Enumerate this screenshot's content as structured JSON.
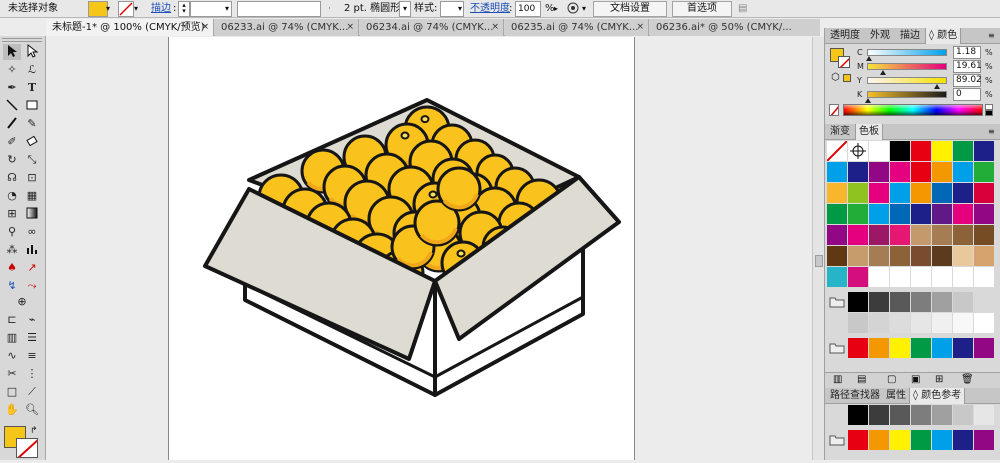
{
  "control_bar": {
    "selection_status": "未选择对象",
    "stroke_label": "描边",
    "stroke_weight_value": "",
    "brush_size_label": "2 pt. 椭圆形",
    "style_label": "样式:",
    "opacity_label": "不透明度",
    "opacity_value": "100",
    "opacity_unit": "%",
    "doc_setup_button": "文档设置",
    "preferences_button": "首选项",
    "fill_color": "#f5c518"
  },
  "tabs": [
    {
      "label": "未标题-1* @ 100% (CMYK/预览)",
      "close": "×"
    },
    {
      "label": "06233.ai @ 74% (CMYK...",
      "close": "×"
    },
    {
      "label": "06234.ai @ 74% (CMYK...",
      "close": "×"
    },
    {
      "label": "06235.ai @ 74% (CMYK...",
      "close": "×"
    },
    {
      "label": "06236.ai* @ 50% (CMYK/...",
      "close": ""
    }
  ],
  "color_panel": {
    "tabs": [
      "透明度",
      "外观",
      "描边",
      "◊ 颜色"
    ],
    "channels": [
      {
        "label": "C",
        "value": "1.18",
        "fraction": 0.0118,
        "track_start": "#ffffff",
        "track_end": "#00a0e9"
      },
      {
        "label": "M",
        "value": "19.61",
        "fraction": 0.1961,
        "track_start": "#f5e53a",
        "track_end": "#e4007f"
      },
      {
        "label": "Y",
        "value": "89.02",
        "fraction": 0.8902,
        "track_start": "#fdf4f4",
        "track_end": "#f5e000"
      },
      {
        "label": "K",
        "value": "0",
        "fraction": 0.0,
        "track_start": "#f6c02a",
        "track_end": "#1a1a1a"
      }
    ],
    "unit": "%"
  },
  "swatches_panel": {
    "tabs": [
      "渐变",
      "色板"
    ],
    "rows": [
      [
        "none",
        "registration",
        "#ffffff",
        "#000000",
        "#e60012",
        "#fff100",
        "#009944",
        "#1d2088",
        "#e4007f",
        "#00a0e9",
        "#e60033",
        "#009a3e"
      ],
      [
        "#00a0e9",
        "#1d2088",
        "#920783",
        "#e4007f",
        "#e60012",
        "#f39800",
        "#00a0e9",
        "#22ac38",
        "#f8b62d",
        "#ea5414",
        "#e85298",
        "#fff100"
      ],
      [
        "#f8b62d",
        "#8fc31f",
        "#e4007f",
        "#00a0e9",
        "#f39800",
        "#0068b7",
        "#1d2088",
        "#d7003a",
        "#009e96",
        "#c30d23",
        "#601986",
        "#f6ab00"
      ],
      [
        "#009944",
        "#22ac38",
        "#00a0e9",
        "#0068b7",
        "#1d2088",
        "#601986",
        "#e4007f",
        "#920783",
        "#c30d23",
        "#8fc31f",
        "#036eb8",
        "#b3d465"
      ],
      [
        "#920783",
        "#e4007f",
        "#9c1766",
        "#e61673",
        "#c49a6c",
        "#a67c52",
        "#8c6239",
        "#754c24",
        "#603913",
        "#8c6239",
        "#a67c52",
        "#c69c6d"
      ],
      [
        "#603913",
        "#c69c6d",
        "#a67c52",
        "#8c6239",
        "#7a4b2e",
        "#5c3a1d",
        "#e9c89b",
        "#d6a26e",
        "#b47d47",
        "#7b5231",
        "#4d2e16",
        "#ffffff"
      ],
      [
        "#28b4c8",
        "#d40f7d",
        "#ffffff",
        "#ffffff",
        "#ffffff",
        "#ffffff",
        "#ffffff",
        "#ffffff"
      ]
    ],
    "group1": [
      "folder",
      "#000000",
      "#3c3c3c",
      "#595959",
      "#7d7d7d",
      "#a0a0a0",
      "#c8c8c8"
    ],
    "group1_row2": [
      "#c8c8c8",
      "#d4d4d4",
      "#dcdcdc",
      "#e6e6e6",
      "#f0f0f0",
      "#f8f8f8",
      "#ffffff"
    ],
    "group2": [
      "folder",
      "#e60012",
      "#f39800",
      "#fff100",
      "#009944",
      "#00a0e9",
      "#1d2088",
      "#920783"
    ],
    "footer_icons": [
      "swatch-library-icon",
      "show-kinds-icon",
      "swatch-options-icon",
      "new-color-group-icon",
      "new-swatch-icon",
      "delete-swatch-icon"
    ]
  },
  "bottom_panel": {
    "tabs": [
      "路径查找器",
      "属性",
      "◊ 颜色参考"
    ],
    "row1": [
      "#000000",
      "#3c3c3c",
      "#595959",
      "#7d7d7d",
      "#a0a0a0",
      "#c8c8c8",
      "#e6e6e6"
    ],
    "row2": [
      "folder",
      "#e60012",
      "#f39800",
      "#fff100",
      "#009944",
      "#00a0e9",
      "#1d2088",
      "#920783"
    ]
  },
  "icons": {
    "selection": "selection-tool-icon",
    "direct_selection": "direct-selection-tool-icon",
    "magic_wand": "magic-wand-icon",
    "lasso": "lasso-icon",
    "pen": "pen-tool-icon",
    "type": "type-tool-icon",
    "line": "line-segment-icon",
    "rectangle": "rectangle-tool-icon",
    "paintbrush": "paintbrush-icon",
    "pencil": "pencil-icon",
    "blob": "blob-brush-icon",
    "eraser": "eraser-icon",
    "rotate": "rotate-tool-icon",
    "scale": "scale-tool-icon",
    "warp": "warp-tool-icon",
    "free_transform": "free-transform-icon",
    "shape_builder": "shape-builder-icon",
    "perspective": "perspective-grid-icon",
    "mesh": "mesh-tool-icon",
    "gradient": "gradient-tool-icon",
    "eyedropper": "eyedropper-icon",
    "blend": "blend-tool-icon",
    "symbol_sprayer": "symbol-sprayer-icon",
    "column_graph": "column-graph-icon",
    "artboard": "artboard-tool-icon",
    "slice": "slice-tool-icon",
    "hand": "hand-tool-icon",
    "zoom": "zoom-tool-icon"
  },
  "artwork": {
    "fruit_color": "#f9c21c",
    "fruit_shadow": "#f0a81a",
    "fruit_highlight": "#fde15a",
    "box_flap_color": "#dedbd2",
    "box_side_color": "#ffffff",
    "outline_color": "#161616"
  }
}
